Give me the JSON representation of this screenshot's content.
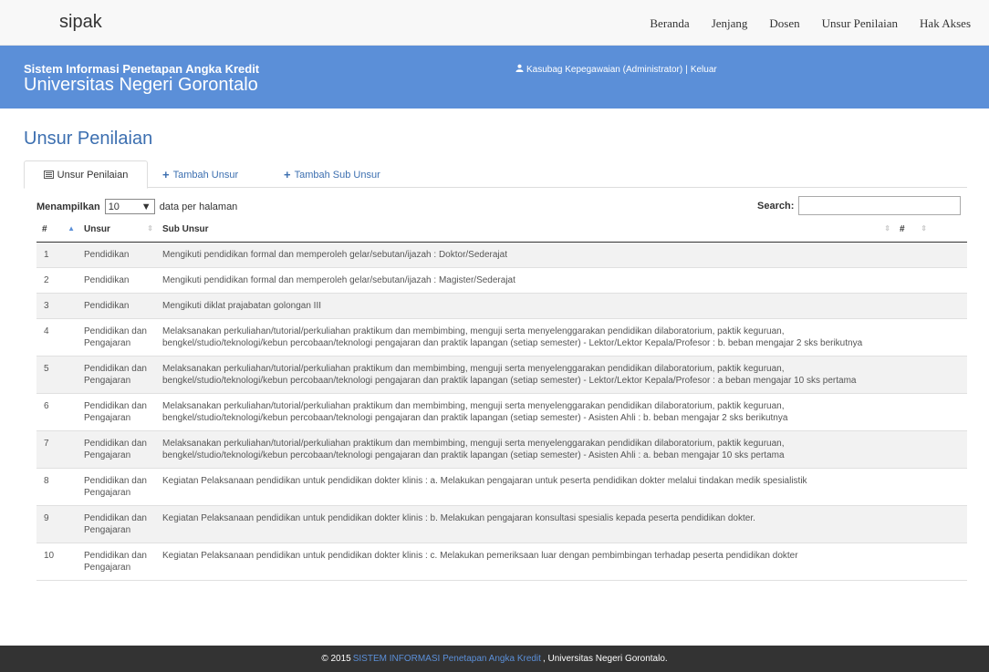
{
  "navbar": {
    "brand": "sipak",
    "links": [
      "Beranda",
      "Jenjang",
      "Dosen",
      "Unsur Penilaian",
      "Hak Akses"
    ]
  },
  "header": {
    "subtitle": "Sistem Informasi Penetapan Angka Kredit",
    "title": "Universitas Negeri Gorontalo",
    "user": "Kasubag Kepegawaian (Administrator)",
    "separator": "|",
    "logout": "Keluar"
  },
  "page": {
    "title": "Unsur Penilaian"
  },
  "tabs": [
    "Unsur Penilaian",
    "Tambah Unsur",
    "Tambah Sub Unsur"
  ],
  "controls": {
    "length_before": "Menampilkan",
    "length_value": "10",
    "length_after": "data per halaman",
    "search_label": "Search:"
  },
  "table": {
    "headers": [
      "#",
      "Unsur",
      "Sub Unsur",
      "",
      "#"
    ],
    "rows": [
      {
        "no": "1",
        "unsur": "Pendidikan",
        "sub": "Mengikuti pendidikan formal dan memperoleh gelar/sebutan/ijazah : Doktor/Sederajat"
      },
      {
        "no": "2",
        "unsur": "Pendidikan",
        "sub": "Mengikuti pendidikan formal dan memperoleh gelar/sebutan/ijazah : Magister/Sederajat"
      },
      {
        "no": "3",
        "unsur": "Pendidikan",
        "sub": "Mengikuti diklat prajabatan golongan III"
      },
      {
        "no": "4",
        "unsur": "Pendidikan dan Pengajaran",
        "sub": "Melaksanakan perkuliahan/tutorial/perkuliahan praktikum dan membimbing, menguji serta menyelenggarakan pendidikan dilaboratorium, paktik keguruan, bengkel/studio/teknologi/kebun percobaan/teknologi pengajaran dan praktik lapangan (setiap semester) - Lektor/Lektor Kepala/Profesor : b. beban mengajar 2 sks berikutnya"
      },
      {
        "no": "5",
        "unsur": "Pendidikan dan Pengajaran",
        "sub": "Melaksanakan perkuliahan/tutorial/perkuliahan praktikum dan membimbing, menguji serta menyelenggarakan pendidikan dilaboratorium, paktik keguruan, bengkel/studio/teknologi/kebun percobaan/teknologi pengajaran dan praktik lapangan (setiap semester) - Lektor/Lektor Kepala/Profesor : a beban mengajar 10 sks pertama"
      },
      {
        "no": "6",
        "unsur": "Pendidikan dan Pengajaran",
        "sub": "Melaksanakan perkuliahan/tutorial/perkuliahan praktikum dan membimbing, menguji serta menyelenggarakan pendidikan dilaboratorium, paktik keguruan, bengkel/studio/teknologi/kebun percobaan/teknologi pengajaran dan praktik lapangan (setiap semester) - Asisten Ahli : b. beban mengajar 2 sks berikutnya"
      },
      {
        "no": "7",
        "unsur": "Pendidikan dan Pengajaran",
        "sub": "Melaksanakan perkuliahan/tutorial/perkuliahan praktikum dan membimbing, menguji serta menyelenggarakan pendidikan dilaboratorium, paktik keguruan, bengkel/studio/teknologi/kebun percobaan/teknologi pengajaran dan praktik lapangan (setiap semester) - Asisten Ahli : a. beban mengajar 10 sks pertama"
      },
      {
        "no": "8",
        "unsur": "Pendidikan dan Pengajaran",
        "sub": "Kegiatan Pelaksanaan pendidikan untuk pendidikan dokter klinis : a. Melakukan pengajaran untuk peserta pendidikan dokter melalui tindakan medik spesialistik"
      },
      {
        "no": "9",
        "unsur": "Pendidikan dan Pengajaran",
        "sub": "Kegiatan Pelaksanaan pendidikan untuk pendidikan dokter klinis : b. Melakukan pengajaran konsultasi spesialis kepada peserta pendidikan dokter."
      },
      {
        "no": "10",
        "unsur": "Pendidikan dan Pengajaran",
        "sub": "Kegiatan Pelaksanaan pendidikan untuk pendidikan dokter klinis : c. Melakukan pemeriksaan luar dengan pembimbingan terhadap peserta pendidikan dokter"
      }
    ]
  },
  "footer": {
    "prefix": "© 2015",
    "link": "SISTEM INFORMASI Penetapan Angka Kredit",
    "suffix": ", Universitas Negeri Gorontalo."
  }
}
